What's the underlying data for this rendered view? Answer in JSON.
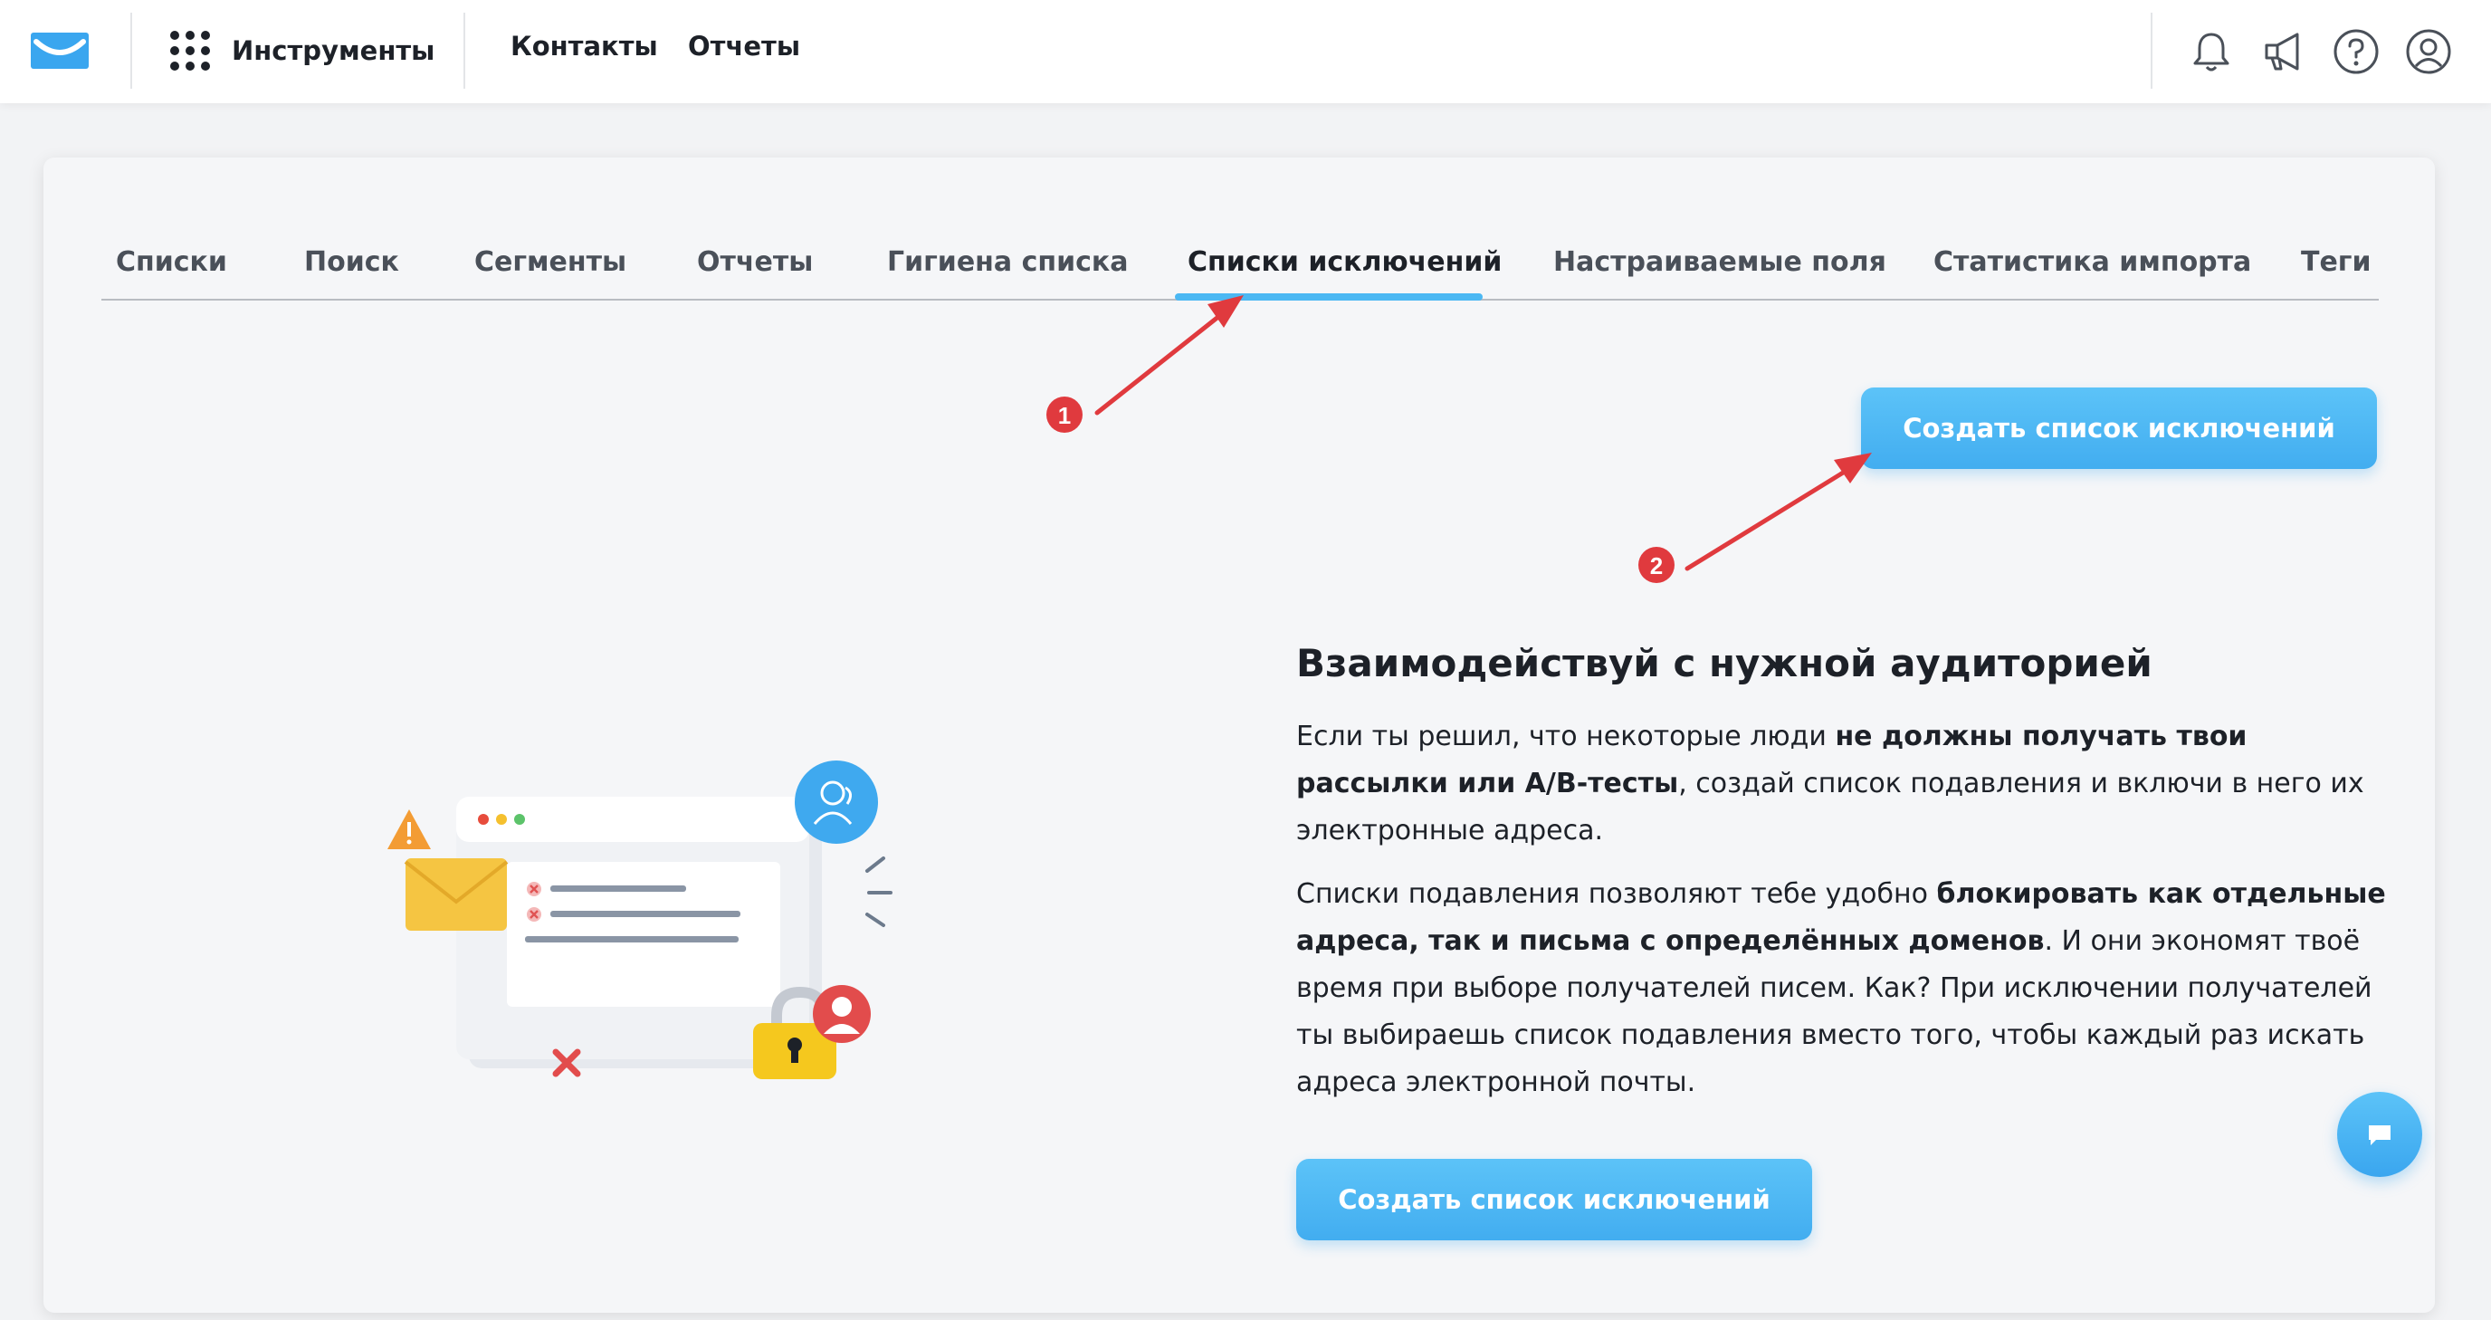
{
  "topbar": {
    "logo_icon": "envelope-logo-icon",
    "tools_label": "Инструменты",
    "nav": [
      "Контакты",
      "Отчеты"
    ],
    "icons": [
      "bell-icon",
      "megaphone-icon",
      "help-icon",
      "user-icon"
    ]
  },
  "tabs": [
    {
      "label": "Списки"
    },
    {
      "label": "Поиск"
    },
    {
      "label": "Сегменты"
    },
    {
      "label": "Отчеты"
    },
    {
      "label": "Гигиена списка"
    },
    {
      "label": "Списки исключений",
      "active": true
    },
    {
      "label": "Настраиваемые поля"
    },
    {
      "label": "Статистика импорта"
    },
    {
      "label": "Теги"
    }
  ],
  "create_button_label": "Создать список исключений",
  "headline": "Взаимодействуй с нужной аудиторией",
  "paragraph1": {
    "t1": "Если ты решил, что некоторые люди ",
    "b1": "не должны получать твои рассылки или A/B-тесты",
    "t2": ", создай список подавления и включи в него их электронные адреса."
  },
  "paragraph2": {
    "t1": "Списки подавления позволяют тебе удобно ",
    "b1": "блокировать как отдельные адреса, так и письма с определённых доменов",
    "t2": ". И они экономят твоё время при выборе получателей писем. Как? При исключении получателей ты выбираешь список подавления вместо того, чтобы каждый раз искать адреса электронной почты."
  },
  "annotations": {
    "marker1": "1",
    "marker2": "2",
    "color": "#e03a3e"
  },
  "colors": {
    "accent": "#4bb8f3",
    "text": "#1d2128",
    "tab_text": "#4a5059"
  }
}
